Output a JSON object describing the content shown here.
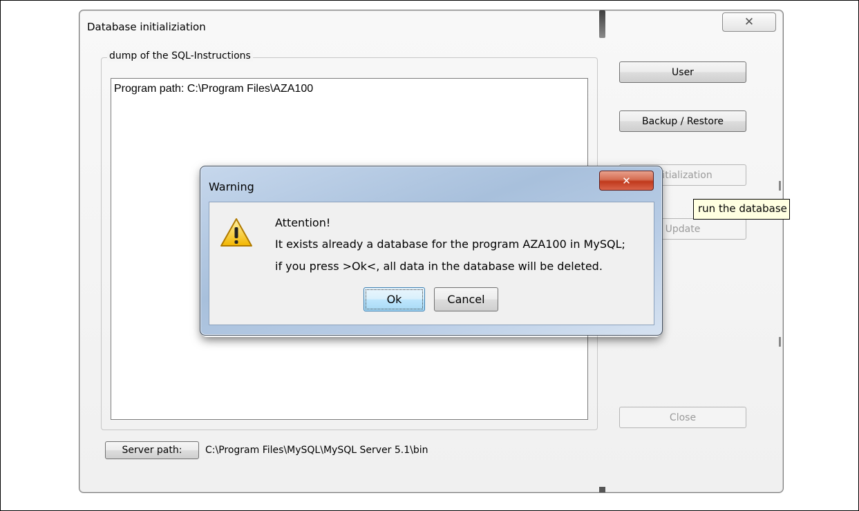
{
  "main_window": {
    "title": "Database initializiation",
    "close_glyph": "✕",
    "group_label": "dump of the SQL-Instructions",
    "sql_lines": [
      "Program path: C:\\Program Files\\AZA100"
    ],
    "buttons": {
      "user": "User",
      "backup_restore": "Backup / Restore",
      "initialization": "Initialization",
      "update": "Update",
      "close": "Close"
    },
    "server_path_button": "Server path:",
    "server_path_value": "C:\\Program Files\\MySQL\\MySQL Server 5.1\\bin",
    "tooltip": "run the database"
  },
  "warning_dialog": {
    "title": "Warning",
    "close_glyph": "✕",
    "icon": "warning-icon",
    "lines": [
      "Attention!",
      "It exists already a database for the program AZA100 in MySQL;",
      "if you press >Ok<, all data in the database will be deleted."
    ],
    "ok_label": "Ok",
    "cancel_label": "Cancel"
  }
}
